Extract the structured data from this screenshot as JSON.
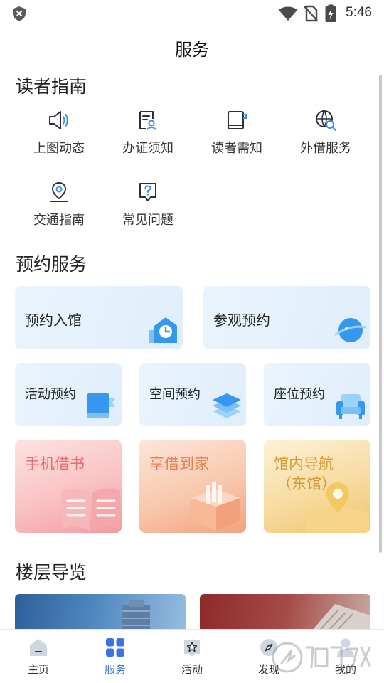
{
  "status_bar": {
    "time": "5:46"
  },
  "header": {
    "title": "服务"
  },
  "reader_guide": {
    "title": "读者指南",
    "items": [
      {
        "label": "上图动态",
        "icon": "speaker-icon"
      },
      {
        "label": "办证须知",
        "icon": "card-document-icon"
      },
      {
        "label": "读者需知",
        "icon": "notebook-icon"
      },
      {
        "label": "外借服务",
        "icon": "globe-search-icon"
      },
      {
        "label": "交通指南",
        "icon": "location-pin-icon"
      },
      {
        "label": "常见问题",
        "icon": "question-icon"
      }
    ]
  },
  "reservation": {
    "title": "预约服务",
    "large": [
      {
        "label": "预约入馆",
        "icon": "clock-house-icon"
      },
      {
        "label": "参观预约",
        "icon": "planet-icon"
      }
    ],
    "small": [
      {
        "label": "活动预约",
        "icon": "book-flag-icon"
      },
      {
        "label": "空间预约",
        "icon": "layers-icon"
      },
      {
        "label": "座位预约",
        "icon": "armchair-icon"
      }
    ],
    "feature": [
      {
        "label": "手机借书",
        "icon": "open-book-icon",
        "color": "#e96d73"
      },
      {
        "label": "享借到家",
        "icon": "parcel-box-icon",
        "color": "#e57e52"
      },
      {
        "label": "馆内导航",
        "label2": "（东馆）",
        "icon": "map-pin-icon",
        "color": "#d39a2d"
      }
    ]
  },
  "floor_guide": {
    "title": "楼层导览"
  },
  "tab_bar": {
    "tabs": [
      {
        "label": "主页",
        "icon": "home-icon",
        "active": false
      },
      {
        "label": "服务",
        "icon": "grid-icon",
        "active": true
      },
      {
        "label": "活动",
        "icon": "star-badge-icon",
        "active": false
      },
      {
        "label": "发现",
        "icon": "compass-icon",
        "active": false
      },
      {
        "label": "我的",
        "icon": "user-icon",
        "active": false
      }
    ]
  },
  "colors": {
    "accent": "#3b74e0",
    "icon_dark": "#2b2f3a",
    "icon_accent": "#3b8fe8",
    "tile_bg": "#e4f1fc"
  }
}
